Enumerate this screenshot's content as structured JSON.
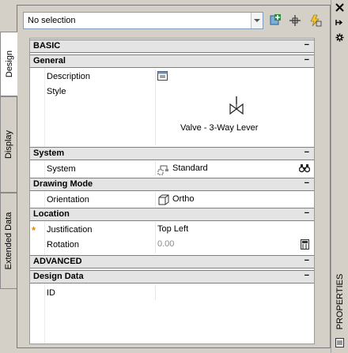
{
  "toolbar": {
    "selection_value": "No selection"
  },
  "tabs": [
    {
      "label": "Design"
    },
    {
      "label": "Display"
    },
    {
      "label": "Extended Data"
    }
  ],
  "right_strip": {
    "label": "PROPERTIES"
  },
  "sections": {
    "basic": {
      "label": "BASIC",
      "toggle": "−"
    },
    "general": {
      "label": "General",
      "toggle": "−",
      "description_label": "Description",
      "style_label": "Style",
      "style_value": "Valve - 3-Way Lever"
    },
    "system": {
      "label": "System",
      "toggle": "−",
      "system_label": "System",
      "system_value": "Standard"
    },
    "drawing_mode": {
      "label": "Drawing Mode",
      "toggle": "−",
      "orientation_label": "Orientation",
      "orientation_value": "Ortho"
    },
    "location": {
      "label": "Location",
      "toggle": "−",
      "justification_marker": "*",
      "justification_label": "Justification",
      "justification_value": "Top Left",
      "rotation_label": "Rotation",
      "rotation_value": "0.00"
    },
    "advanced": {
      "label": "ADVANCED",
      "toggle": "−"
    },
    "design_data": {
      "label": "Design Data",
      "toggle": "−",
      "id_label": "ID"
    }
  },
  "colors": {
    "panel_bg": "#d4d0c8",
    "category_bg": "#e4e4e4",
    "marker_orange": "#e08a00",
    "add_icon_green": "#2e8b3a"
  },
  "icons": [
    "add-style-icon",
    "select-objects-icon",
    "quick-select-icon",
    "close-icon",
    "auto-hide-icon",
    "options-icon",
    "description-edit-icon",
    "style-preview-valve-icon",
    "system-icon",
    "binoculars-icon",
    "orientation-cube-icon",
    "rotation-calculator-icon",
    "properties-page-icon"
  ]
}
